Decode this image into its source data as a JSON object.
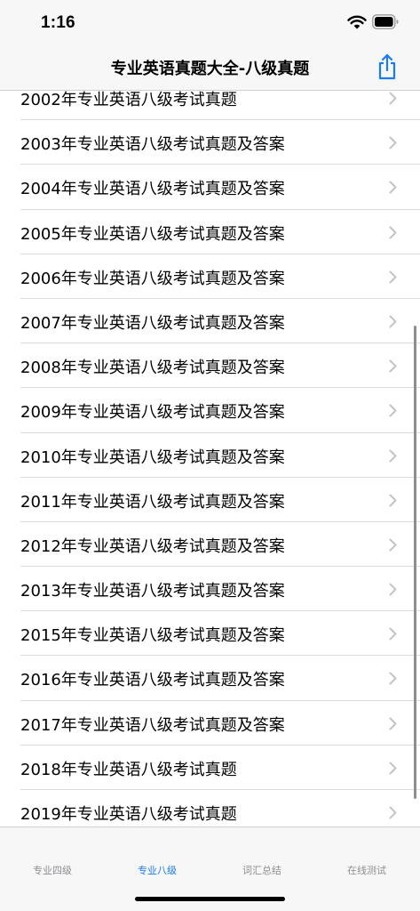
{
  "status_bar": {
    "time": "1:16",
    "icons": [
      "wifi-icon",
      "battery-icon"
    ]
  },
  "nav": {
    "title": "专业英语真题大全-八级真题",
    "share_icon": "share-icon",
    "accent_color": "#1a7cf5"
  },
  "list": {
    "items": [
      "2002年专业英语八级考试真题",
      "2003年专业英语八级考试真题及答案",
      "2004年专业英语八级考试真题及答案",
      "2005年专业英语八级考试真题及答案",
      "2006年专业英语八级考试真题及答案",
      "2007年专业英语八级考试真题及答案",
      "2008年专业英语八级考试真题及答案",
      "2009年专业英语八级考试真题及答案",
      "2010年专业英语八级考试真题及答案",
      "2011年专业英语八级考试真题及答案",
      "2012年专业英语八级考试真题及答案",
      "2013年专业英语八级考试真题及答案",
      "2015年专业英语八级考试真题及答案",
      "2016年专业英语八级考试真题及答案",
      "2017年专业英语八级考试真题及答案",
      "2018年专业英语八级考试真题",
      "2019年专业英语八级考试真题"
    ],
    "row_icon": "chevron-right-icon"
  },
  "tabs": [
    {
      "label": "专业四级",
      "active": false
    },
    {
      "label": "专业八级",
      "active": true
    },
    {
      "label": "词汇总结",
      "active": false
    },
    {
      "label": "在线测试",
      "active": false
    }
  ]
}
